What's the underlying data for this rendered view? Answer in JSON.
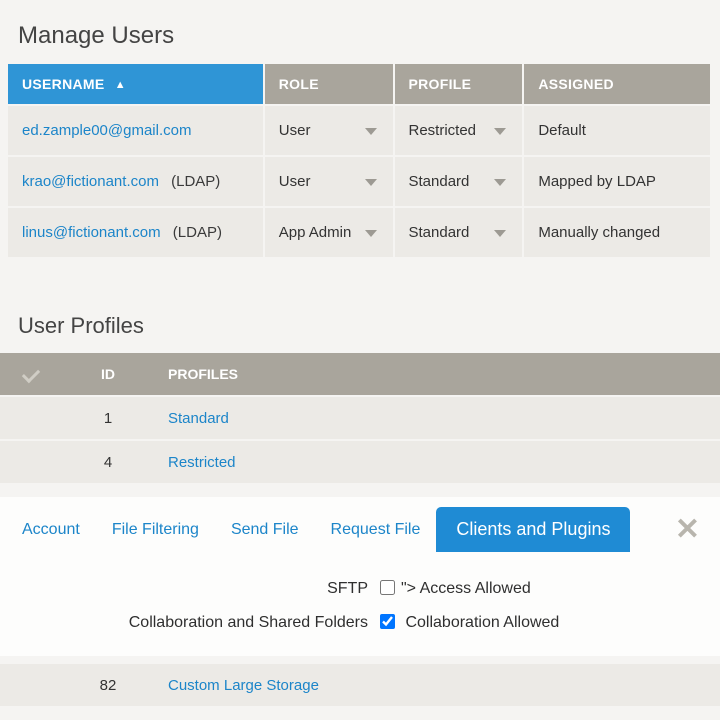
{
  "manage_users": {
    "title": "Manage Users",
    "columns": {
      "username": "USERNAME",
      "role": "ROLE",
      "profile": "PROFILE",
      "assigned": "ASSIGNED"
    },
    "rows": [
      {
        "username": "ed.zample00@gmail.com",
        "ldap": "",
        "role": "User",
        "profile": "Restricted",
        "assigned": "Default"
      },
      {
        "username": "krao@fictionant.com",
        "ldap": "(LDAP)",
        "role": "User",
        "profile": "Standard",
        "assigned": "Mapped by LDAP"
      },
      {
        "username": "linus@fictionant.com",
        "ldap": "(LDAP)",
        "role": "App Admin",
        "profile": "Standard",
        "assigned": "Manually changed"
      }
    ]
  },
  "user_profiles": {
    "title": "User Profiles",
    "columns": {
      "id": "ID",
      "profiles": "PROFILES"
    },
    "rows": [
      {
        "id": "1",
        "name": "Standard"
      },
      {
        "id": "4",
        "name": "Restricted"
      }
    ],
    "extra_row": {
      "id": "82",
      "name": "Custom Large Storage"
    }
  },
  "tabs": {
    "account": "Account",
    "file_filtering": "File Filtering",
    "send_file": "Send File",
    "request_file": "Request File",
    "clients_plugins": "Clients and Plugins"
  },
  "settings": {
    "sftp_label": "SFTP",
    "sftp_control": "Access Allowed",
    "collab_label": "Collaboration and Shared Folders",
    "collab_control": "Collaboration Allowed"
  }
}
